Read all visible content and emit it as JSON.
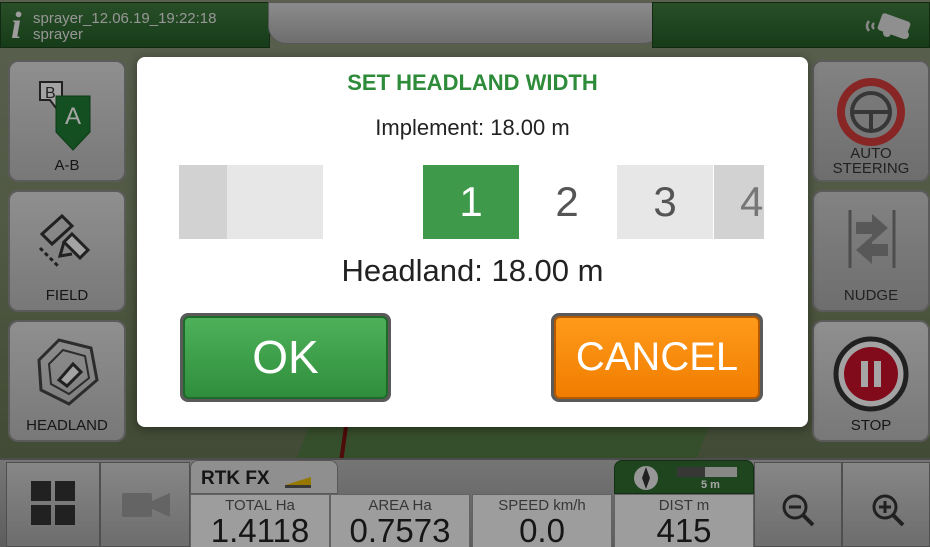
{
  "topbar": {
    "file_title": "sprayer_12.06.19_19:22:18",
    "file_subtitle": "sprayer"
  },
  "left_panel": {
    "ab_label": "A-B",
    "ab_icon_letter_a": "A",
    "ab_icon_letter_b": "B",
    "field_label": "FIELD",
    "headland_label": "HEADLAND"
  },
  "right_panel": {
    "auto_label_line1": "AUTO",
    "auto_label_line2": "STEERING",
    "nudge_label": "NUDGE",
    "stop_label": "STOP"
  },
  "bottombar": {
    "rtk_status": "RTK FX",
    "scale_label": "5 m",
    "metrics": [
      {
        "label": "TOTAL Ha",
        "value": "1.4118"
      },
      {
        "label": "AREA Ha",
        "value": "0.7573"
      },
      {
        "label": "SPEED km/h",
        "value": "0.0"
      },
      {
        "label": "DIST m",
        "value": "415"
      }
    ]
  },
  "dialog": {
    "title": "SET HEADLAND WIDTH",
    "implement": "Implement: 18.00 m",
    "picker_values": [
      "1",
      "2",
      "3",
      "4"
    ],
    "selected_value": "1",
    "headland": "Headland: 18.00 m",
    "ok_label": "OK",
    "cancel_label": "CANCEL"
  },
  "colors": {
    "accent_green": "#3e9a4a",
    "cancel_orange": "#f58a0b",
    "title_green": "#2e8b3a"
  }
}
